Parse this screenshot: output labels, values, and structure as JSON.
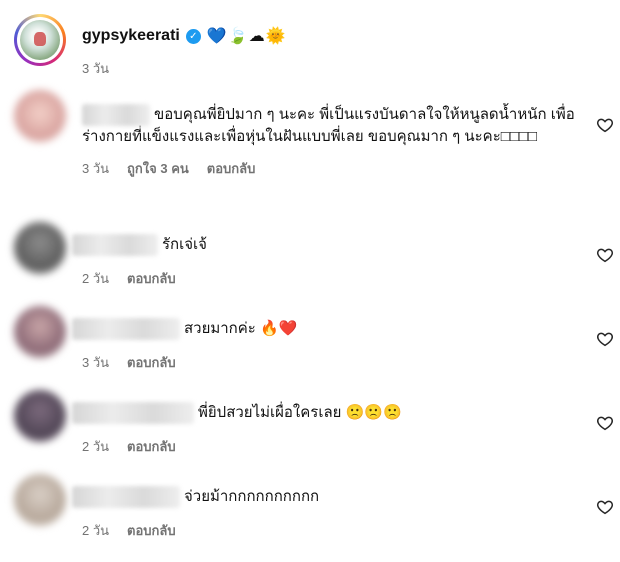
{
  "post": {
    "username": "gypsykeerati",
    "verified_mark": "✓",
    "emojis": "💙🍃☁🌞",
    "time": "3 วัน"
  },
  "comments": [
    {
      "text": "ขอบคุณพี่ยิปมาก ๆ นะคะ พี่เป็นแรงบันดาลใจให้หนูลดน้ำหนัก เพื่อร่างกายที่แข็งแรงและเพื่อหุ่นในฝันแบบพี่เลย ขอบคุณมาก ๆ นะคะ□□□□",
      "time": "3 วัน",
      "likes": "ถูกใจ 3 คน",
      "reply": "ตอบกลับ"
    },
    {
      "text": "รักเจ่เจ้",
      "time": "2 วัน",
      "reply": "ตอบกลับ"
    },
    {
      "text": "สวยมากค่ะ 🔥❤️",
      "time": "3 วัน",
      "reply": "ตอบกลับ"
    },
    {
      "text": "พี่ยิปสวยไม่เผื่อใครเลย 🙁🙁🙁",
      "time": "2 วัน",
      "reply": "ตอบกลับ"
    },
    {
      "text": "จ่วยม้ากกกกกกกกกก",
      "time": "2 วัน",
      "reply": "ตอบกลับ"
    }
  ],
  "icons": {
    "like": "heart-outline-icon",
    "verified": "verified-badge-icon"
  },
  "colors": {
    "verified": "#1d9bf0",
    "meta_text": "#737373"
  }
}
